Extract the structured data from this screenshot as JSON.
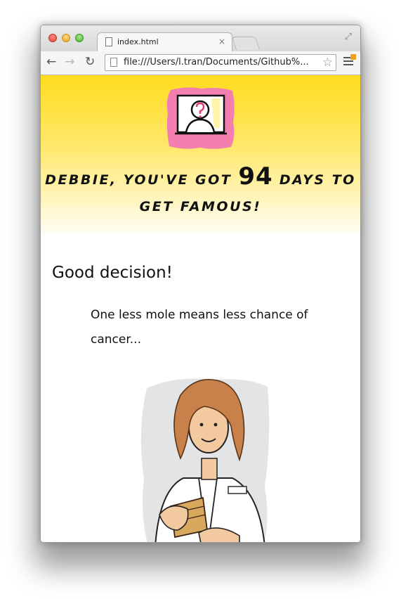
{
  "browser": {
    "tab_title": "index.html",
    "tab_close": "×",
    "url": "file:///Users/l.tran/Documents/Github%..."
  },
  "page": {
    "countdown_prefix": "DEBBIE, YOU'VE GOT",
    "days": "94",
    "countdown_suffix_1": "DAYS TO",
    "countdown_suffix_2": "GET FAMOUS!",
    "headline": "Good decision!",
    "message": "One less mole means less chance of cancer..."
  },
  "colors": {
    "hero_top": "#ffdc1e",
    "avatar_pink": "#f27fb0"
  }
}
